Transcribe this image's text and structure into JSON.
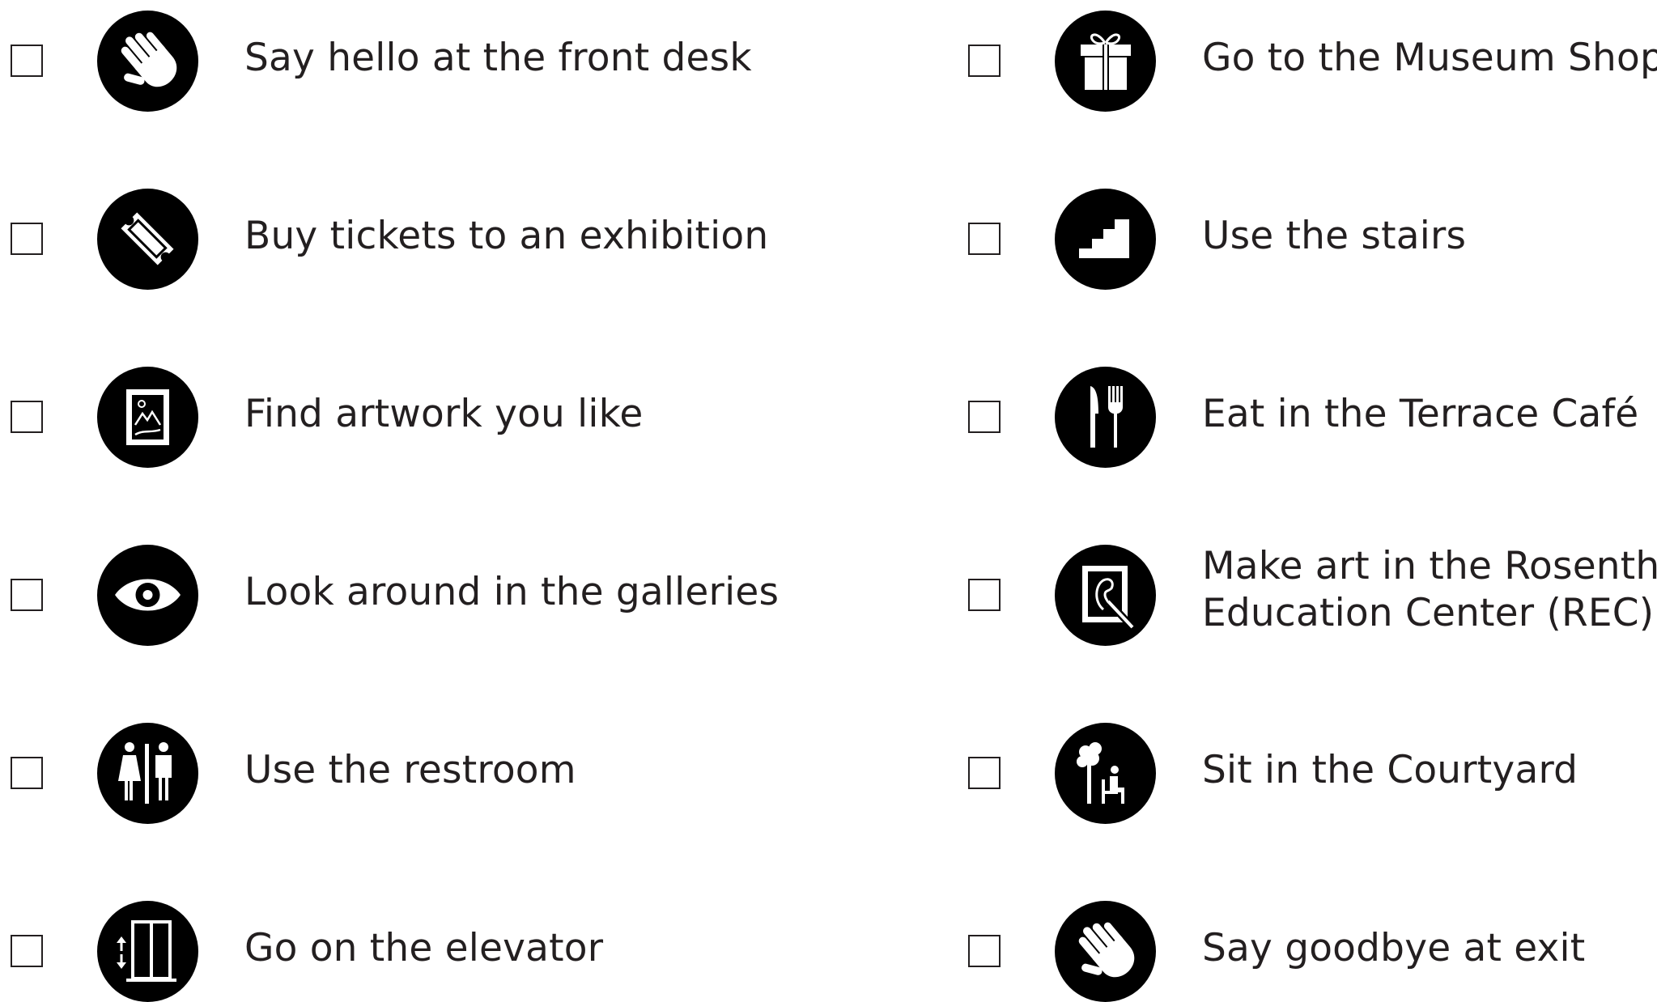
{
  "colors": {
    "text": "#231f20",
    "icon_background": "#000000",
    "icon_foreground": "#ffffff",
    "page_background": "#ffffff"
  },
  "left_column": [
    {
      "icon": "waving-hand-icon",
      "label": "Say hello at the front desk"
    },
    {
      "icon": "ticket-icon",
      "label": "Buy tickets to an exhibition"
    },
    {
      "icon": "framed-artwork-icon",
      "label": "Find artwork you like"
    },
    {
      "icon": "eye-icon",
      "label": "Look around in the galleries"
    },
    {
      "icon": "restroom-icon",
      "label": "Use the restroom"
    },
    {
      "icon": "elevator-icon",
      "label": "Go on the elevator"
    }
  ],
  "right_column": [
    {
      "icon": "gift-icon",
      "label": "Go to the Museum Shop"
    },
    {
      "icon": "stairs-icon",
      "label": "Use the stairs"
    },
    {
      "icon": "knife-fork-icon",
      "label": "Eat in the Terrace Café"
    },
    {
      "icon": "art-making-icon",
      "label_line1": "Make art in the Rosenthal",
      "label_line2": "Education Center (REC)"
    },
    {
      "icon": "courtyard-seating-icon",
      "label": "Sit in the Courtyard"
    },
    {
      "icon": "waving-hand-icon",
      "label": "Say goodbye at exit"
    }
  ]
}
